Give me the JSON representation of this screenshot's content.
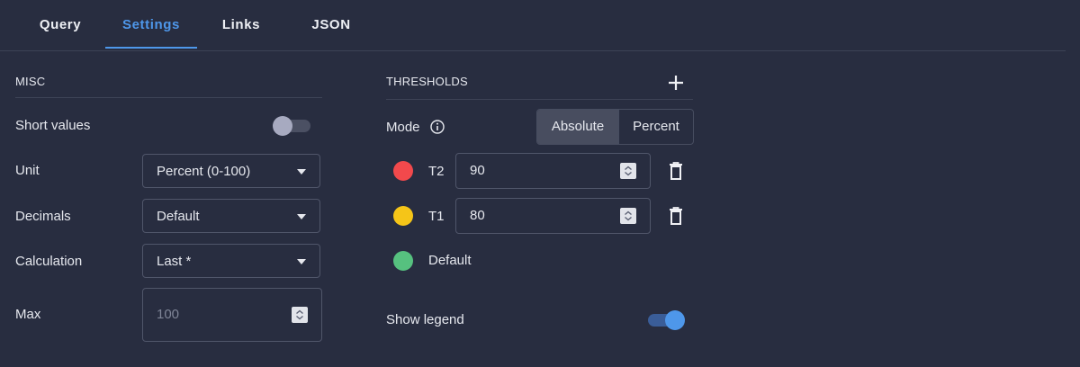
{
  "tabs": [
    {
      "label": "Query",
      "active": false
    },
    {
      "label": "Settings",
      "active": true
    },
    {
      "label": "Links",
      "active": false
    },
    {
      "label": "JSON",
      "active": false
    }
  ],
  "misc": {
    "title": "MISC",
    "short_values": {
      "label": "Short values",
      "on": false
    },
    "unit": {
      "label": "Unit",
      "value": "Percent (0-100)"
    },
    "decimals": {
      "label": "Decimals",
      "value": "Default"
    },
    "calculation": {
      "label": "Calculation",
      "value": "Last *"
    },
    "max": {
      "label": "Max",
      "placeholder": "100",
      "value": ""
    }
  },
  "thresholds": {
    "title": "THRESHOLDS",
    "add_icon": "plus-icon",
    "mode": {
      "label": "Mode",
      "info_icon": "info-icon",
      "options": [
        "Absolute",
        "Percent"
      ],
      "selected": "Absolute"
    },
    "items": [
      {
        "name": "T2",
        "value": "90",
        "color": "#f2494c"
      },
      {
        "name": "T1",
        "value": "80",
        "color": "#f5c518"
      }
    ],
    "default": {
      "name": "Default",
      "color": "#56c17f"
    },
    "show_legend": {
      "label": "Show legend",
      "on": true
    }
  },
  "colors": {
    "accent": "#4e97ea",
    "background": "#282d40"
  }
}
